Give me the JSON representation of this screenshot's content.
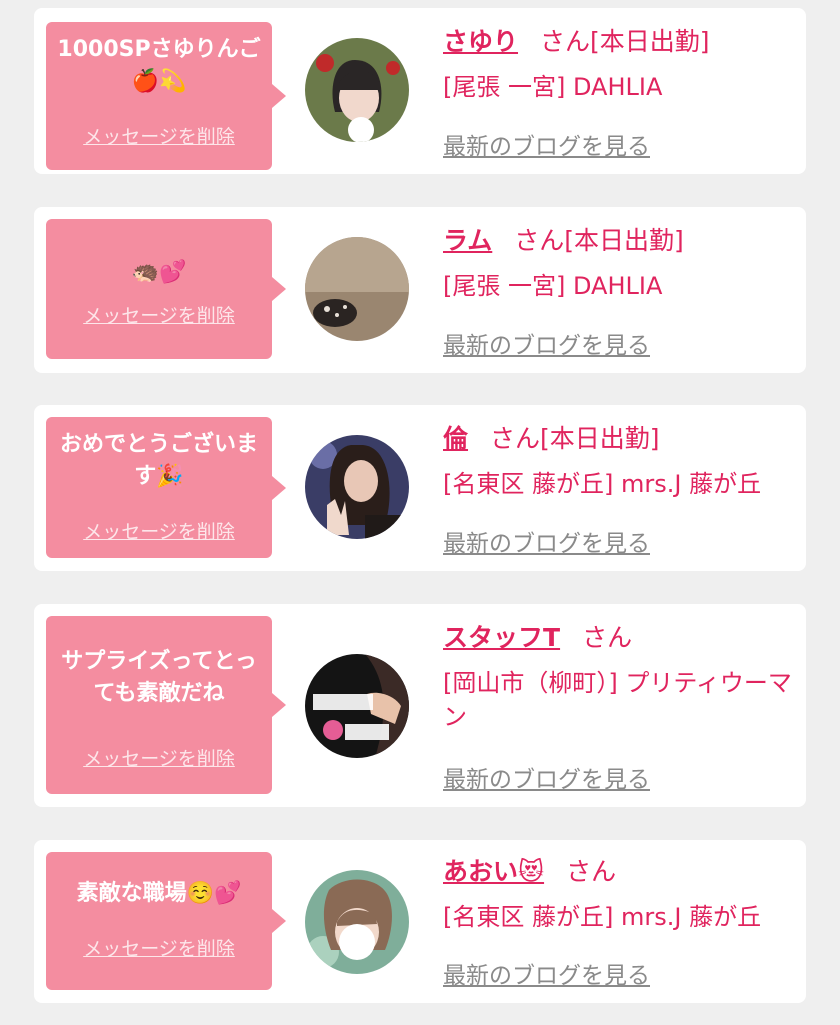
{
  "messages": [
    {
      "text": "1000SPさゆりんご🍎💫",
      "delete_label": "メッセージを削除",
      "name": "さゆり",
      "honorific": "さん",
      "status": "[本日出勤]",
      "shop": "[尾張 一宮] DAHLIA",
      "blog_label": "最新のブログを見る"
    },
    {
      "text": "🦔💕",
      "delete_label": "メッセージを削除",
      "name": "ラム",
      "honorific": "さん",
      "status": "[本日出勤]",
      "shop": "[尾張 一宮] DAHLIA",
      "blog_label": "最新のブログを見る"
    },
    {
      "text": "おめでとうございます🎉",
      "delete_label": "メッセージを削除",
      "name": "倫",
      "honorific": "さん",
      "status": "[本日出勤]",
      "shop": "[名東区 藤が丘] mrs.J 藤が丘",
      "blog_label": "最新のブログを見る"
    },
    {
      "text": "サプライズってとっても素敵だね",
      "delete_label": "メッセージを削除",
      "name": "スタッフT",
      "honorific": "さん",
      "status": "",
      "shop": "[岡山市（柳町）] プリティウーマン",
      "blog_label": "最新のブログを見る"
    },
    {
      "text": "素敵な職場☺️💕",
      "delete_label": "メッセージを削除",
      "name": "あおい😻",
      "honorific": "さん",
      "status": "",
      "shop": "[名東区 藤が丘] mrs.J 藤が丘",
      "blog_label": "最新のブログを見る"
    }
  ],
  "colors": {
    "bubble": "#f48da0",
    "accent": "#e0245e",
    "muted_link": "#8a8a8a",
    "background": "#efefef"
  }
}
